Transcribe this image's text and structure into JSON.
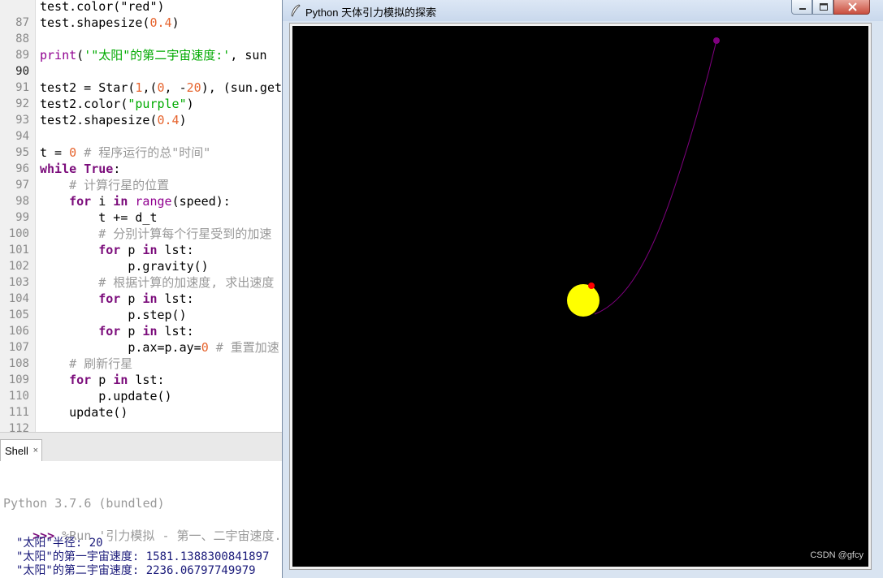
{
  "editor": {
    "lines": [
      {
        "num": "",
        "cls": "",
        "html": "<span class='p'>test.color(\"red\")</span>"
      },
      {
        "num": "87",
        "cls": "",
        "html": "test.shapesize(<span class='num'>0.4</span>)"
      },
      {
        "num": "88",
        "cls": "",
        "html": ""
      },
      {
        "num": "89",
        "cls": "",
        "html": "<span class='b'>print</span>(<span class='str'>'\"太阳\"的第二宇宙速度:'</span>, sun"
      },
      {
        "num": "90",
        "cls": "cur",
        "html": ""
      },
      {
        "num": "91",
        "cls": "",
        "html": "test2 = Star(<span class='num'>1</span>,(<span class='num'>0</span>, -<span class='num'>20</span>), (sun.get"
      },
      {
        "num": "92",
        "cls": "",
        "html": "test2.color(<span class='str'>\"purple\"</span>)"
      },
      {
        "num": "93",
        "cls": "",
        "html": "test2.shapesize(<span class='num'>0.4</span>)"
      },
      {
        "num": "94",
        "cls": "",
        "html": ""
      },
      {
        "num": "95",
        "cls": "",
        "html": "t = <span class='num'>0</span> <span class='c'># 程序运行的总\"时间\"</span>"
      },
      {
        "num": "96",
        "cls": "",
        "html": "<span class='k2'>while</span> <span class='k2'>True</span>:"
      },
      {
        "num": "97",
        "cls": "",
        "html": "    <span class='c'># 计算行星的位置</span>"
      },
      {
        "num": "98",
        "cls": "",
        "html": "    <span class='k2'>for</span> i <span class='k2'>in</span> <span class='b'>range</span>(speed):"
      },
      {
        "num": "99",
        "cls": "",
        "html": "        t += d_t"
      },
      {
        "num": "100",
        "cls": "",
        "html": "        <span class='c'># 分别计算每个行星受到的加速</span>"
      },
      {
        "num": "101",
        "cls": "",
        "html": "        <span class='k2'>for</span> p <span class='k2'>in</span> lst:"
      },
      {
        "num": "102",
        "cls": "",
        "html": "            p.gravity()"
      },
      {
        "num": "103",
        "cls": "",
        "html": "        <span class='c'># 根据计算的加速度, 求出速度</span>"
      },
      {
        "num": "104",
        "cls": "",
        "html": "        <span class='k2'>for</span> p <span class='k2'>in</span> lst:"
      },
      {
        "num": "105",
        "cls": "",
        "html": "            p.step()"
      },
      {
        "num": "106",
        "cls": "",
        "html": "        <span class='k2'>for</span> p <span class='k2'>in</span> lst:"
      },
      {
        "num": "107",
        "cls": "",
        "html": "            p.ax=p.ay=<span class='num'>0</span> <span class='c'># 重置加速</span>"
      },
      {
        "num": "108",
        "cls": "",
        "html": "    <span class='c'># 刷新行星</span>"
      },
      {
        "num": "109",
        "cls": "",
        "html": "    <span class='k2'>for</span> p <span class='k2'>in</span> lst:"
      },
      {
        "num": "110",
        "cls": "",
        "html": "        p.update()"
      },
      {
        "num": "111",
        "cls": "",
        "html": "    update()"
      },
      {
        "num": "112",
        "cls": "",
        "html": ""
      }
    ]
  },
  "shell": {
    "tab_label": "Shell",
    "tab_close": "×",
    "version_line": "Python 3.7.6 (bundled)",
    "prompt": ">>>",
    "run_command": " %Run '引力模拟 - 第一、二宇宙速度.py",
    "output": [
      "\"太阳\"半径: 20",
      "\"太阳\"的第一宇宙速度: 1581.1388300841897",
      "\"太阳\"的第二宇宙速度: 2236.06797749979"
    ]
  },
  "turtle_window": {
    "title": "Python 天体引力模拟的探索",
    "watermark": "CSDN @gfcy",
    "colors": {
      "canvas": "#000000",
      "sun": "#ffff00",
      "test": "#ff0000",
      "test2": "#800080"
    }
  }
}
